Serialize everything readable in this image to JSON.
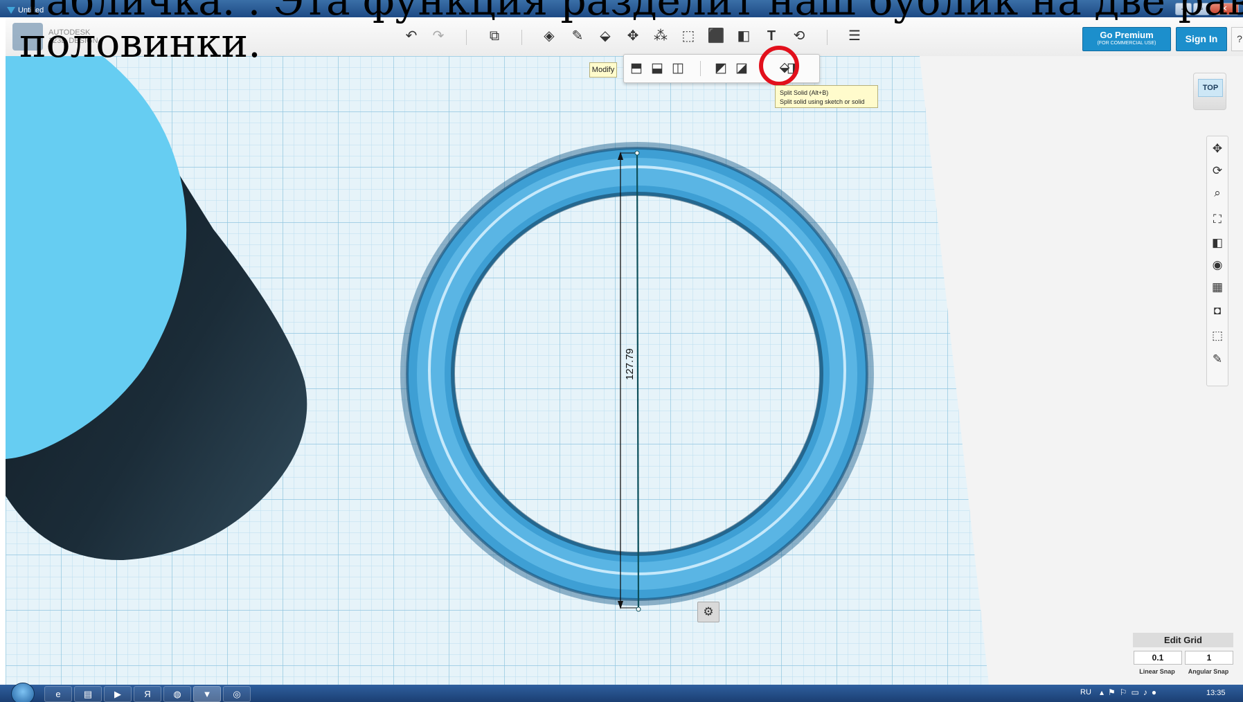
{
  "caption": {
    "line1": "Табличка. . Эта функция разделит наш бублик на две равные",
    "line2": "половинки."
  },
  "window": {
    "title": "Untitled"
  },
  "app": {
    "name_line1": "AUTODESK",
    "name_line2": "123D DESIGN"
  },
  "toolbar": {
    "icons": [
      "undo-icon",
      "redo-icon",
      "new-object-icon",
      "primitives-icon",
      "sketch-icon",
      "construct-icon",
      "modify-icon",
      "pattern-icon",
      "grouping-icon",
      "combine-icon",
      "measure-icon",
      "text-icon",
      "snap-icon",
      "material-icon"
    ],
    "premium_label": "Go Premium",
    "premium_sub": "(FOR COMMERCIAL USE)",
    "signin_label": "Sign In",
    "help_label": "?"
  },
  "modify": {
    "label": "Modify",
    "tooltip_title": "Split Solid (Alt+B)",
    "tooltip_text": "Split solid using sketch or solid"
  },
  "viewcube": {
    "face_label": "TOP"
  },
  "canvas": {
    "dimension_value": "127.79"
  },
  "edit_grid": {
    "title": "Edit Grid",
    "linear_value": "0.1",
    "angular_value": "1",
    "linear_label": "Linear Snap",
    "angular_label": "Angular Snap"
  },
  "taskbar": {
    "language": "RU",
    "clock": "13:35"
  },
  "colors": {
    "torus": "#4fa9dc",
    "cylinder_top": "#66cdf2",
    "cylinder_side": "#16242f",
    "grid_line": "#a9d7ea",
    "highlight": "#e2101c",
    "accent": "#1c8fcc"
  }
}
